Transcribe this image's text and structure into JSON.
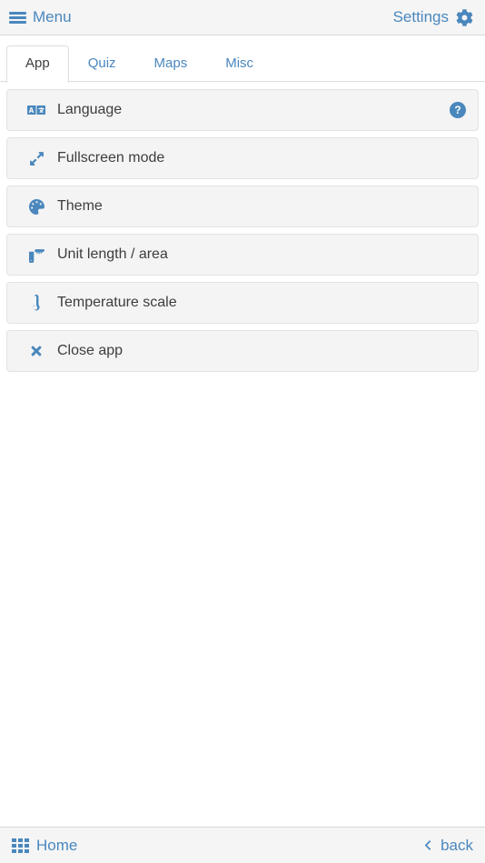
{
  "header": {
    "menu_label": "Menu",
    "menu_icon": "hamburger-icon",
    "settings_label": "Settings",
    "settings_icon": "gear-icon"
  },
  "tabs": {
    "items": [
      {
        "label": "App",
        "active": true
      },
      {
        "label": "Quiz",
        "active": false
      },
      {
        "label": "Maps",
        "active": false
      },
      {
        "label": "Misc",
        "active": false
      }
    ]
  },
  "settings_list": {
    "items": [
      {
        "label": "Language",
        "icon": "language-icon",
        "help": "?"
      },
      {
        "label": "Fullscreen mode",
        "icon": "expand-arrows-icon"
      },
      {
        "label": "Theme",
        "icon": "palette-icon"
      },
      {
        "label": "Unit length / area",
        "icon": "ruler-icon"
      },
      {
        "label": "Temperature scale",
        "icon": "thermometer-icon"
      },
      {
        "label": "Close app",
        "icon": "close-x-icon"
      }
    ]
  },
  "footer": {
    "home_label": "Home",
    "home_icon": "grid-icon",
    "back_label": "back",
    "back_icon": "chevron-left-icon"
  },
  "colors": {
    "accent": "#4a87bd",
    "text": "#3d3d3d",
    "bar_bg": "#f5f5f5",
    "item_bg": "#f4f4f4",
    "border": "#dddddd"
  }
}
